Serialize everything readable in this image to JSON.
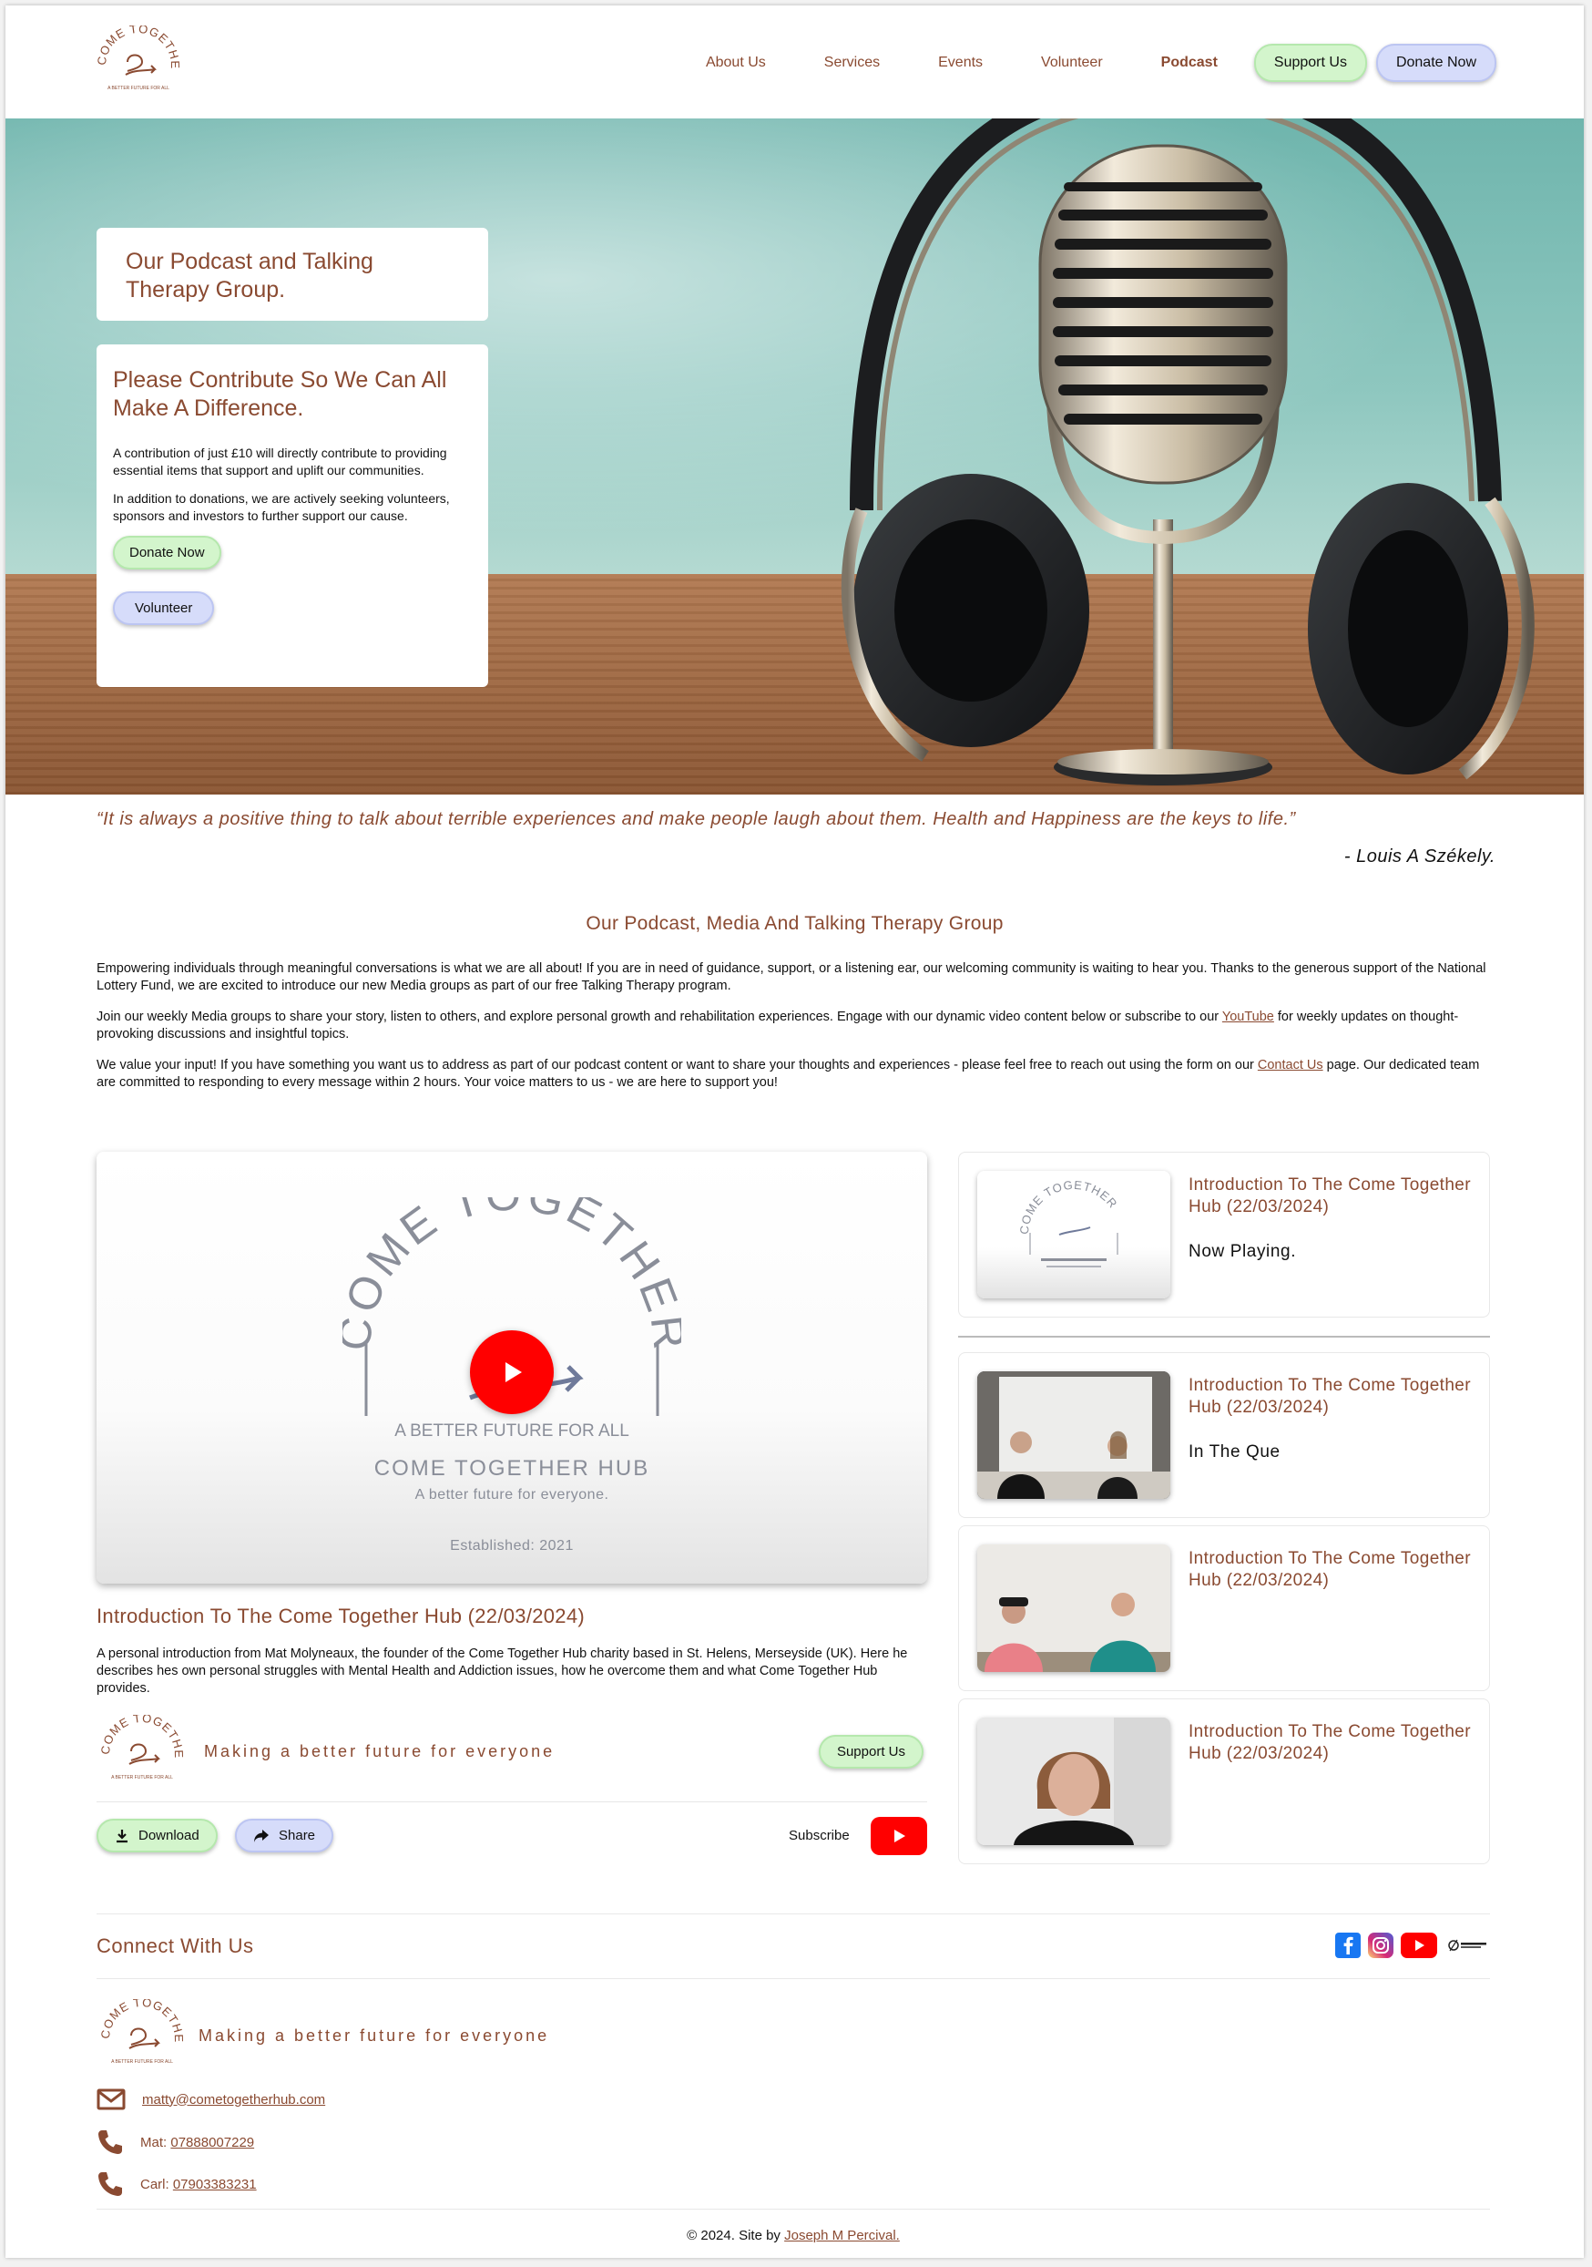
{
  "colors": {
    "brand": "#8a4a31",
    "support_green": "#d3f5cc",
    "donate_blue": "#d6dcfa",
    "youtube_red": "#ff0000"
  },
  "header": {
    "logo_text": "COME TOGETHER",
    "logo_sub": "A BETTER FUTURE FOR ALL",
    "nav": [
      "About Us",
      "Services",
      "Events",
      "Volunteer",
      "Podcast"
    ],
    "active": "Podcast",
    "support_label": "Support Us",
    "donate_label": "Donate Now"
  },
  "hero": {
    "title": "Our Podcast and Talking Therapy Group.",
    "contribute_title": "Please Contribute So We Can All Make A Difference.",
    "contribute_p1": "A contribution of just £10 will directly contribute to providing essential items that support and uplift our communities.",
    "contribute_p2": "In addition to donations, we are actively seeking volunteers, sponsors and investors to further support our cause.",
    "donate_label": "Donate Now",
    "volunteer_label": "Volunteer"
  },
  "quote": {
    "text": "“It is always a positive thing to talk about terrible experiences and make people laugh about them. Health and Happiness are the keys to life.”",
    "author": "- Louis A Székely."
  },
  "intro": {
    "title": "Our Podcast, Media And Talking Therapy Group",
    "p1": "Empowering individuals through meaningful conversations is what we are all about! If you are in need of guidance, support, or a listening ear, our welcoming community is waiting to hear you. Thanks to the generous support of the National Lottery Fund, we are excited to introduce our new Media groups as part of our free Talking Therapy program.",
    "p2_before": "Join our weekly Media groups to share your story, listen to others, and explore personal growth and rehabilitation experiences. Engage with our dynamic video content below or subscribe to our ",
    "p2_link": "YouTube",
    "p2_after": " for weekly updates on thought-provoking discussions and insightful topics.",
    "p3_before": "We value your input! If you have something you want us to address as part of our podcast content or want to share your thoughts and experiences - please feel free to reach out using the form on our ",
    "p3_link": "Contact Us",
    "p3_after": " page. Our dedicated team are committed to responding to every message within 2 hours. Your voice matters to us - we are here to support you!"
  },
  "video": {
    "overlay_top": "COME TOGETHER",
    "overlay_sub": "A BETTER FUTURE FOR ALL",
    "overlay_hub": "COME TOGETHER HUB",
    "overlay_tag": "A better future for everyone.",
    "overlay_est": "Established: 2021",
    "title": "Introduction To The Come Together Hub (22/03/2024)",
    "description": "A personal introduction from Mat Molyneaux, the founder of the Come Together Hub charity based in St. Helens, Merseyside (UK). Here he describes hes own personal struggles with Mental Health and Addiction issues, how he overcome them and what Come Together Hub provides.",
    "tagline": "Making a better future for everyone",
    "support_label": "Support Us",
    "download_label": "Download",
    "share_label": "Share",
    "subscribe_label": "Subscribe"
  },
  "playlist": [
    {
      "title": "Introduction To The Come Together Hub (22/03/2024)",
      "status": "Now Playing."
    },
    {
      "title": "Introduction To The Come Together Hub (22/03/2024)",
      "status": "In The Que"
    },
    {
      "title": "Introduction To The Come Together Hub (22/03/2024)",
      "status": ""
    },
    {
      "title": "Introduction To The Come Together Hub (22/03/2024)",
      "status": ""
    }
  ],
  "footer": {
    "connect_title": "Connect With Us",
    "tagline": "Making a better future for everyone",
    "email": "matty@cometogetherhub.com",
    "mat_label": "Mat:",
    "mat_phone": "07888007229",
    "carl_label": "Carl:",
    "carl_phone": "07903383231",
    "copyright": "© 2024. Site by",
    "credit": "Joseph M Percival."
  }
}
